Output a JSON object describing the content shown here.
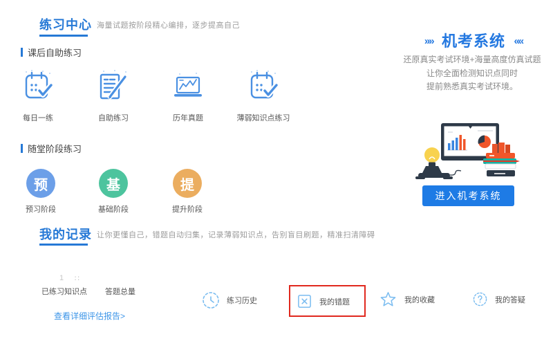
{
  "colors": {
    "primary_blue": "#2679D6",
    "icon_blue": "#4A90E2",
    "light_icon_blue": "#7ABCF0",
    "button_blue": "#1E7BE5",
    "highlight_red": "#E0281E",
    "stage_preview": "#6C9FE8",
    "stage_basic": "#4DC49E",
    "stage_improve": "#EBAD5F"
  },
  "practice_center": {
    "title": "练习中心",
    "subtitle": "海量试题按阶段精心编排，逐步提高自己",
    "selfhelp_label": "课后自助练习",
    "selfhelp_items": [
      {
        "label": "每日一练",
        "icon": "calendar-check-icon"
      },
      {
        "label": "自助练习",
        "icon": "notebook-pen-icon"
      },
      {
        "label": "历年真题",
        "icon": "laptop-chart-icon"
      },
      {
        "label": "薄弱知识点练习",
        "icon": "calendar-check-icon"
      }
    ],
    "stage_label": "随堂阶段练习",
    "stages": [
      {
        "badge": "预",
        "label": "预习阶段",
        "color": "#6C9FE8"
      },
      {
        "badge": "基",
        "label": "基础阶段",
        "color": "#4DC49E"
      },
      {
        "badge": "提",
        "label": "提升阶段",
        "color": "#EBAD5F"
      }
    ]
  },
  "exam_system": {
    "title_prefix": "»",
    "title": "机考系统",
    "title_suffix": "«",
    "desc_line1": "还原真实考试环境+海量高度仿真试题",
    "desc_line2": "让你全面检测知识点同时",
    "desc_line3": "提前熟悉真实考试环境。",
    "enter_button": "进入机考系统"
  },
  "my_records": {
    "title": "我的记录",
    "subtitle": "让你更懂自己，错题自动归集，记录薄弱知识点，告别盲目刷题，精准扫清障碍",
    "stats": [
      {
        "value": "1",
        "label": "已练习知识点"
      },
      {
        "value": "∷",
        "label": "答题总量"
      }
    ],
    "report_link": "查看详细评估报告>",
    "quick_links": [
      {
        "label": "练习历史",
        "icon": "clock-icon",
        "highlighted": false
      },
      {
        "label": "我的错题",
        "icon": "wrong-box-icon",
        "highlighted": true
      },
      {
        "label": "我的收藏",
        "icon": "star-icon",
        "highlighted": false
      },
      {
        "label": "我的答疑",
        "icon": "question-icon",
        "highlighted": false
      }
    ]
  }
}
